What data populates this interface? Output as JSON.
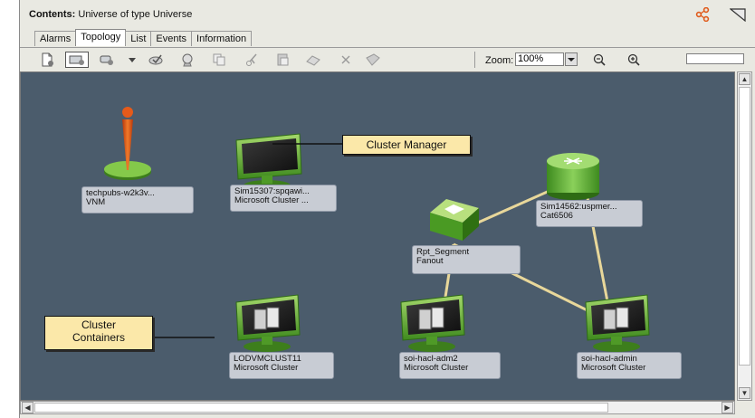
{
  "window": {
    "title_bold": "Contents:",
    "title_rest": " Universe of type Universe"
  },
  "tabs": [
    {
      "label": "Alarms",
      "active": false
    },
    {
      "label": "Topology",
      "active": true
    },
    {
      "label": "List",
      "active": false
    },
    {
      "label": "Events",
      "active": false
    },
    {
      "label": "Information",
      "active": false
    }
  ],
  "toolbar": {
    "zoom_label": "Zoom:",
    "zoom_value": "100%",
    "tools": [
      "new-icon",
      "add-container-icon",
      "add-device-icon",
      "dropdown-arrow-icon",
      "save-icon",
      "find-icon",
      "copy-icon",
      "cut-icon",
      "paste-icon",
      "layout-icon",
      "delete-icon",
      "properties-icon"
    ]
  },
  "nodes": {
    "vnm": {
      "line1": "techpubs-w2k3v...",
      "line2": "VNM"
    },
    "cluster_manager": {
      "line1": "Sim15307:spqawi...",
      "line2": "Microsoft Cluster ..."
    },
    "router": {
      "line1": "Sim14562:uspmer...",
      "line2": "Cat6506"
    },
    "fanout": {
      "line1": "Rpt_Segment",
      "line2": "Fanout"
    },
    "cluster1": {
      "line1": "LODVMCLUST11",
      "line2": "Microsoft Cluster"
    },
    "cluster2": {
      "line1": "soi-hacl-adm2",
      "line2": "Microsoft Cluster"
    },
    "cluster3": {
      "line1": "soi-hacl-admin",
      "line2": "Microsoft Cluster"
    }
  },
  "callouts": {
    "cluster_manager": "Cluster Manager",
    "cluster_containers_line1": "Cluster",
    "cluster_containers_line2": "Containers"
  },
  "colors": {
    "canvas": "#4b5c6c",
    "link": "#e8d79a",
    "node_green": "#7cc243",
    "callout_bg": "#fbe8a9",
    "pin_orange": "#e0551a"
  }
}
